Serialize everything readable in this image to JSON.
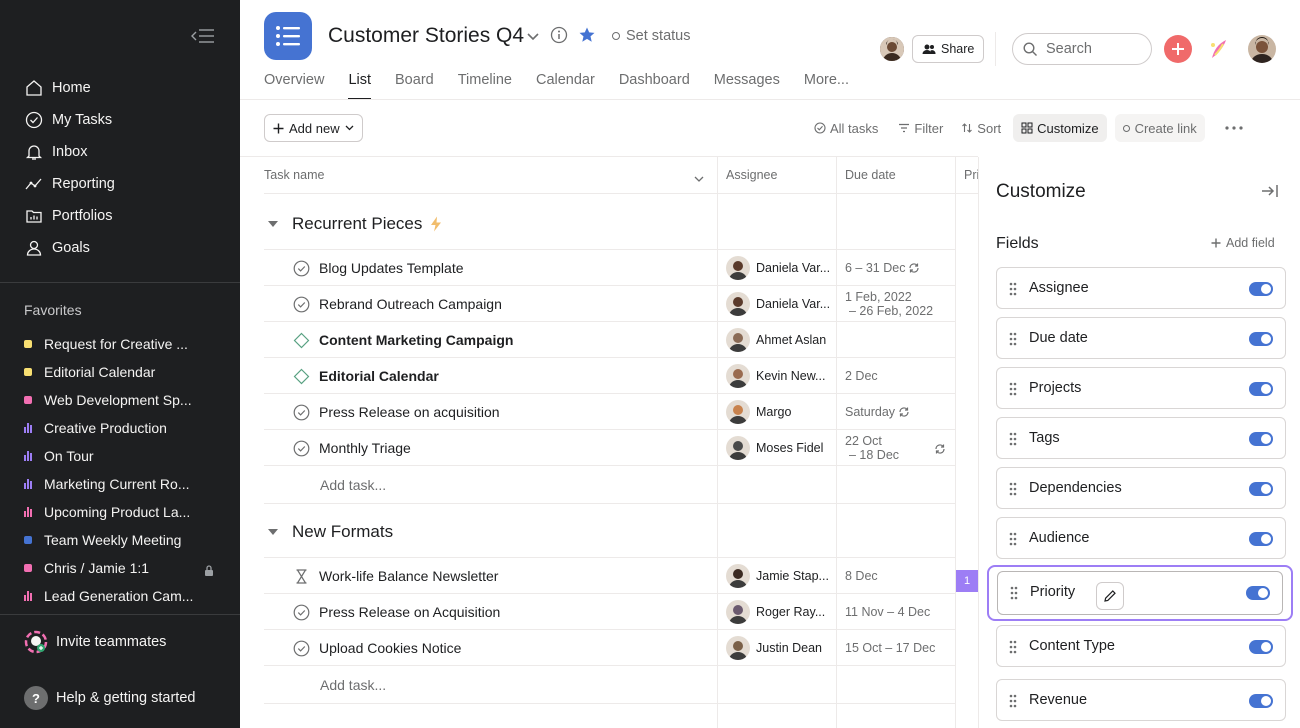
{
  "sidebar": {
    "nav": [
      {
        "label": "Home",
        "icon": "home-icon"
      },
      {
        "label": "My Tasks",
        "icon": "check-circle-icon"
      },
      {
        "label": "Inbox",
        "icon": "bell-icon"
      },
      {
        "label": "Reporting",
        "icon": "trend-line-icon"
      },
      {
        "label": "Portfolios",
        "icon": "folder-chart-icon"
      },
      {
        "label": "Goals",
        "icon": "person-icon"
      }
    ],
    "favorites_heading": "Favorites",
    "favorites": [
      {
        "label": "Request for Creative ...",
        "kind": "dot",
        "color": "#f8df72"
      },
      {
        "label": "Editorial Calendar",
        "kind": "dot",
        "color": "#f8df72"
      },
      {
        "label": "Web Development Sp...",
        "kind": "dot",
        "color": "#f26fb2"
      },
      {
        "label": "Creative Production",
        "kind": "bars",
        "color": "#9d7ef5"
      },
      {
        "label": "On Tour",
        "kind": "bars",
        "color": "#9d7ef5"
      },
      {
        "label": "Marketing Current Ro...",
        "kind": "bars",
        "color": "#9d7ef5"
      },
      {
        "label": "Upcoming Product La...",
        "kind": "bars",
        "color": "#f26fb2"
      },
      {
        "label": "Team Weekly Meeting",
        "kind": "dot",
        "color": "#4573d2"
      },
      {
        "label": "Chris / Jamie 1:1",
        "kind": "dot",
        "color": "#f26fb2",
        "locked": true
      },
      {
        "label": "Lead Generation Cam...",
        "kind": "bars",
        "color": "#f26fb2"
      }
    ],
    "invite_label": "Invite teammates",
    "help_label": "Help & getting started"
  },
  "header": {
    "title": "Customer Stories Q4",
    "set_status": "Set status",
    "share_label": "Share",
    "search_placeholder": "Search",
    "tabs": [
      "Overview",
      "List",
      "Board",
      "Timeline",
      "Calendar",
      "Dashboard",
      "Messages",
      "More..."
    ],
    "active_tab": "List"
  },
  "toolbar": {
    "add_new": "Add new",
    "all_tasks": "All tasks",
    "filter": "Filter",
    "sort": "Sort",
    "customize": "Customize",
    "create_link": "Create link"
  },
  "table": {
    "columns": {
      "task": "Task name",
      "assignee": "Assignee",
      "due": "Due date",
      "extra": "Pri"
    },
    "add_task": "Add task...",
    "sections": [
      {
        "title": "Recurrent Pieces",
        "rows": [
          {
            "name": "Blog Updates Template",
            "status": "check",
            "assignee": "Daniela Var...",
            "due1": "6 – 31 Dec",
            "due2": "",
            "recurring": true,
            "avatar_color": "#5a3a2b"
          },
          {
            "name": "Rebrand Outreach Campaign",
            "status": "check",
            "assignee": "Daniela Var...",
            "due1": "1 Feb, 2022",
            "due2": "– 26 Feb, 2022",
            "recurring": false,
            "avatar_color": "#5a3a2b"
          },
          {
            "name": "Content Marketing Campaign",
            "status": "milestone",
            "bold": true,
            "assignee": "Ahmet Aslan",
            "due1": "",
            "due2": "",
            "recurring": false,
            "avatar_color": "#8a6a55"
          },
          {
            "name": "Editorial Calendar",
            "status": "milestone",
            "bold": true,
            "assignee": "Kevin New...",
            "due1": "2 Dec",
            "due2": "",
            "recurring": false,
            "avatar_color": "#9a6b4f"
          },
          {
            "name": "Press Release on acquisition",
            "status": "check",
            "assignee": "Margo",
            "due1": "Saturday",
            "due2": "",
            "recurring": true,
            "avatar_color": "#c8824d"
          },
          {
            "name": "Monthly Triage",
            "status": "check",
            "assignee": "Moses Fidel",
            "due1": "22 Oct",
            "due2": "– 18 Dec",
            "recurring": true,
            "avatar_color": "#4a4a4a"
          }
        ]
      },
      {
        "title": "New Formats",
        "rows": [
          {
            "name": "Work-life Balance Newsletter",
            "status": "hourglass",
            "assignee": "Jamie Stap...",
            "due1": "8 Dec",
            "due2": "",
            "recurring": false,
            "avatar_color": "#3b2a22"
          },
          {
            "name": "Press Release on Acquisition",
            "status": "check",
            "assignee": "Roger Ray...",
            "due1": "11 Nov – 4 Dec",
            "due2": "",
            "recurring": false,
            "avatar_color": "#6b5a6e"
          },
          {
            "name": "Upload Cookies Notice",
            "status": "check",
            "assignee": "Justin Dean",
            "due1": "15 Oct – 17 Dec",
            "due2": "",
            "recurring": false,
            "avatar_color": "#7a6048"
          }
        ]
      }
    ],
    "priority_badge": "1"
  },
  "customize": {
    "title": "Customize",
    "fields_heading": "Fields",
    "add_field": "Add field",
    "fields": [
      "Assignee",
      "Due date",
      "Projects",
      "Tags",
      "Dependencies",
      "Audience",
      "Priority",
      "Content Type",
      "Revenue"
    ],
    "focused_field": "Priority"
  },
  "colors": {
    "sidebar_bg": "#1e1f21",
    "accent_blue": "#4573d2",
    "add_red": "#f06a6a",
    "focus_purple": "#9d7ef5"
  }
}
